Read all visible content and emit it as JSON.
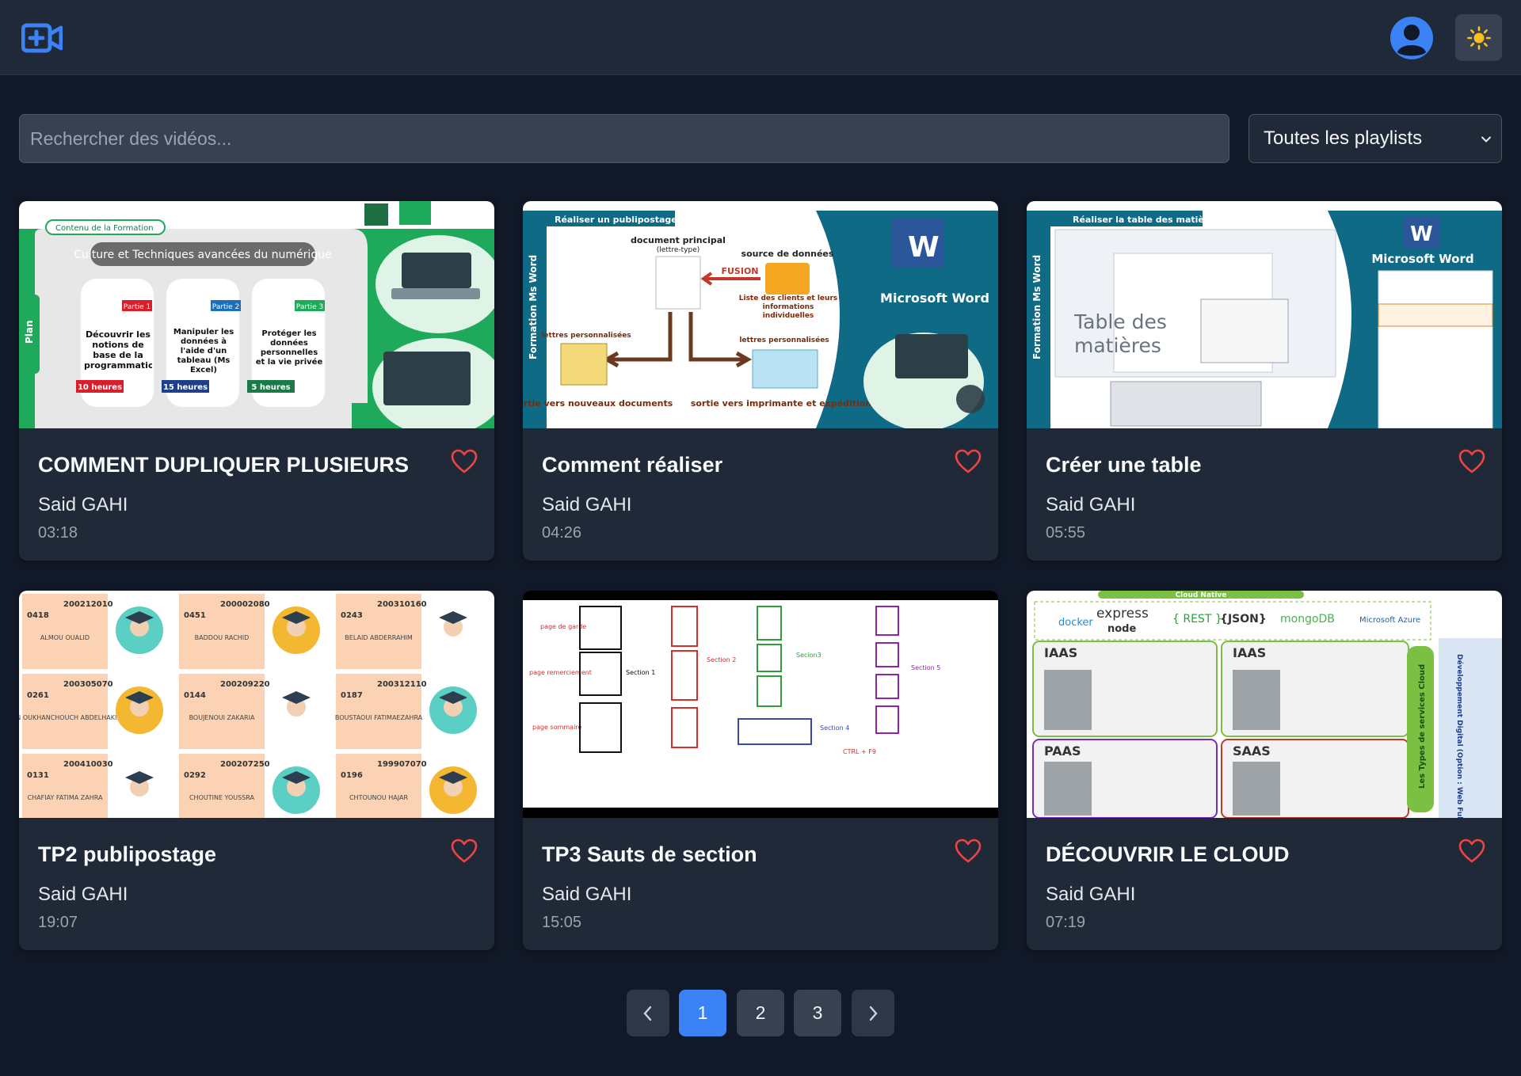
{
  "header": {
    "logo_icon": "video-plus-icon",
    "user_icon": "user-circle-icon",
    "theme_icon": "sun-icon",
    "accent": "#3b82f6",
    "theme_color": "#fbbf24"
  },
  "search": {
    "placeholder": "Rechercher des vidéos...",
    "value": ""
  },
  "playlist_filter": {
    "selected": "Toutes les playlists"
  },
  "videos": [
    {
      "title": "COMMENT DUPLIQUER PLUSIEURS",
      "author": "Said GAHI",
      "duration": "03:18",
      "thumb": {
        "section": "Contenu de la Formation",
        "side": "Plan",
        "banner": "Culture et Techniques avancées du numérique",
        "parts": [
          {
            "tag": "Partie 1",
            "text": "Découvrir les notions de base de la programmation",
            "hours": "10 heures"
          },
          {
            "tag": "Partie 2",
            "text": "Manipuler les données à l'aide d'un tableau (Ms Excel)",
            "hours": "15 heures"
          },
          {
            "tag": "Partie 3",
            "text": "Protéger les données personnelles et la vie privée",
            "hours": "5 heures"
          }
        ]
      }
    },
    {
      "title": "Comment réaliser",
      "author": "Said GAHI",
      "duration": "04:26",
      "thumb": {
        "section": "Réaliser un publipostage",
        "side": "Formation Ms Word",
        "brand": "Microsoft Word",
        "labels": {
          "main_doc": "document principal",
          "main_doc_sub": "(lettre-type)",
          "source": "source de données",
          "fusion": "FUSION",
          "source_sub": "Liste des clients et leurs informations individuelles",
          "left_letters": "lettres personnalisées",
          "right_letters": "lettres personnalisées",
          "out_left": "sortie vers nouveaux documents",
          "out_right": "sortie vers imprimante et expédition"
        }
      }
    },
    {
      "title": "Créer une table",
      "author": "Said GAHI",
      "duration": "05:55",
      "thumb": {
        "section": "Réaliser la table des matières",
        "side": "Formation Ms Word",
        "brand": "Microsoft Word",
        "big_text": "Table des matières"
      }
    },
    {
      "title": "TP2 publipostage",
      "author": "Said GAHI",
      "duration": "19:07",
      "thumb": {
        "students": [
          {
            "id": "200212010",
            "num": "0418",
            "name": "ALMOU OUALID"
          },
          {
            "id": "200002080",
            "num": "0451",
            "name": "BADDOU RACHID"
          },
          {
            "id": "200310160",
            "num": "0243",
            "name": "BELAID ABDERRAHIM"
          },
          {
            "id": "200305070",
            "num": "0261",
            "name": "BEN OUKHANCHOUCH ABDELHAKIM"
          },
          {
            "id": "200209220",
            "num": "0144",
            "name": "BOUJENOUI ZAKARIA"
          },
          {
            "id": "200312110",
            "num": "0187",
            "name": "BOUSTAOUI FATIMAEZAHRA"
          },
          {
            "id": "200410030",
            "num": "0131",
            "name": "CHAFIAY FATIMA ZAHRA"
          },
          {
            "id": "200207250",
            "num": "0292",
            "name": "CHOUTINE YOUSSRA"
          },
          {
            "id": "199907070",
            "num": "0196",
            "name": "CHTOUNOU HAJAR"
          }
        ]
      }
    },
    {
      "title": "TP3 Sauts de section",
      "author": "Said GAHI",
      "duration": "15:05",
      "thumb": {
        "page_garde": "page de garde",
        "page_remerciement": "page remerciement",
        "page_sommaire": "page sommaire",
        "s1": "Section 1",
        "s2": "Section 2",
        "s3": "Secion3",
        "s4": "Section 4",
        "s5": "Section 5",
        "shortcut": "CTRL + F9"
      }
    },
    {
      "title": "DÉCOUVRIR LE CLOUD",
      "author": "Said GAHI",
      "duration": "07:19",
      "thumb": {
        "top_banner": "Cloud Native",
        "logos": [
          "docker",
          "express",
          "node",
          "{ REST }",
          "{JSON}",
          "mongoDB",
          "Microsoft Azure"
        ],
        "blocks": [
          "IAAS",
          "IAAS",
          "PAAS",
          "SAAS"
        ],
        "side": "Les Types de services Cloud",
        "vertical": "Développement Digital (Option : Web FullStack)"
      }
    }
  ],
  "pagination": {
    "prev_icon": "chevron-left-icon",
    "next_icon": "chevron-right-icon",
    "pages": [
      "1",
      "2",
      "3"
    ],
    "active": "1"
  }
}
